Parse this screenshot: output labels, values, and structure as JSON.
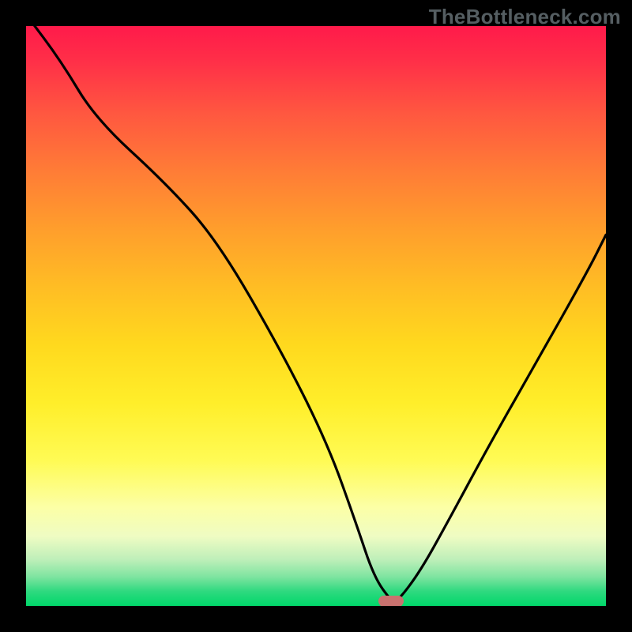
{
  "watermark": "TheBottleneck.com",
  "marker_color": "#c9726f",
  "gradient_stops": [
    {
      "pos": 0,
      "color": "#ff1a4a"
    },
    {
      "pos": 6,
      "color": "#ff2f48"
    },
    {
      "pos": 15,
      "color": "#ff5740"
    },
    {
      "pos": 25,
      "color": "#ff7c36"
    },
    {
      "pos": 35,
      "color": "#ff9e2c"
    },
    {
      "pos": 45,
      "color": "#ffbd24"
    },
    {
      "pos": 55,
      "color": "#ffd91e"
    },
    {
      "pos": 65,
      "color": "#ffee2a"
    },
    {
      "pos": 75,
      "color": "#fffb55"
    },
    {
      "pos": 83,
      "color": "#fcffa6"
    },
    {
      "pos": 88,
      "color": "#effcc3"
    },
    {
      "pos": 92,
      "color": "#beefb9"
    },
    {
      "pos": 95,
      "color": "#7ee4a0"
    },
    {
      "pos": 97.5,
      "color": "#2ed97f"
    },
    {
      "pos": 100,
      "color": "#00d86a"
    }
  ],
  "chart_data": {
    "type": "line",
    "title": "",
    "xlabel": "",
    "ylabel": "",
    "xlim": [
      0,
      100
    ],
    "ylim": [
      0,
      100
    ],
    "series": [
      {
        "name": "bottleneck-curve",
        "x": [
          0,
          6,
          12,
          24,
          33,
          44,
          52,
          57,
          60,
          63,
          64,
          68,
          73,
          80,
          88,
          97,
          100
        ],
        "values": [
          102,
          94,
          84,
          73,
          63,
          44,
          28,
          14,
          5,
          0.8,
          0.7,
          6,
          15,
          28,
          42,
          58,
          64
        ]
      }
    ],
    "optimum_marker": {
      "x": 63,
      "y": 0.8
    },
    "flat_segment": {
      "x_from": 57,
      "x_to": 64,
      "y": 0.8
    }
  }
}
